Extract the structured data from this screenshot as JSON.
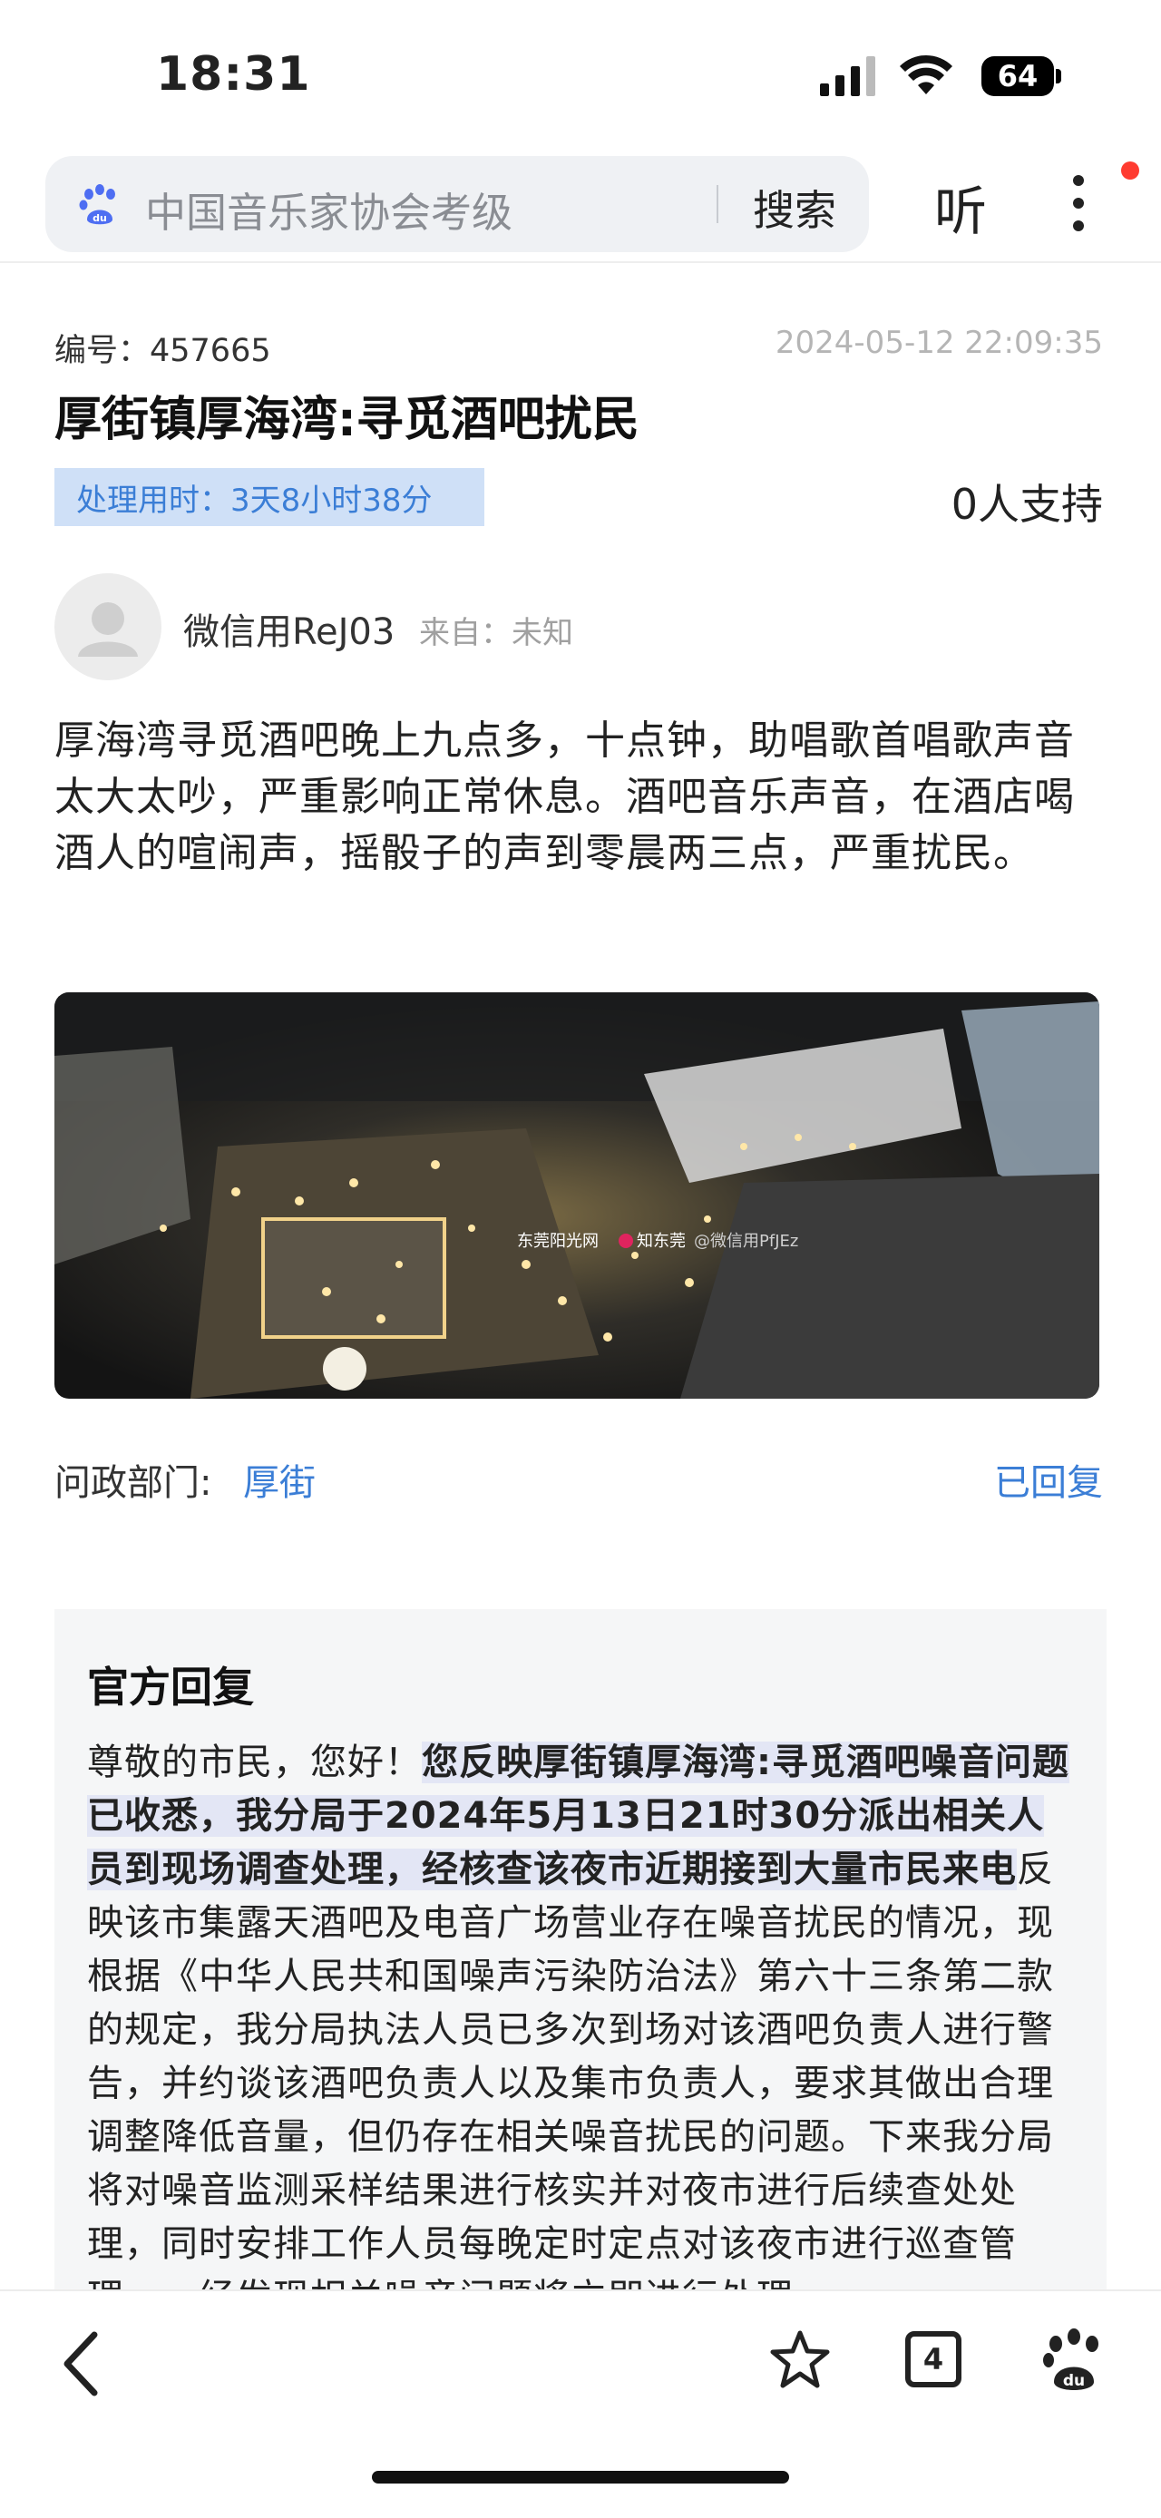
{
  "status_bar": {
    "time": "18:31",
    "battery": "64"
  },
  "header": {
    "search_text": "中国音乐家协会考级",
    "search_button": "搜索",
    "listen_button": "听"
  },
  "post": {
    "id_label": "编号：457665",
    "datetime": "2024-05-12 22:09:35",
    "title": "厚街镇厚海湾:寻觅酒吧扰民",
    "processing_time": "处理用时：3天8小时38分",
    "support_count": "0人支持",
    "user_name": "微信用ReJ03",
    "from_label": "来自：未知",
    "content": "厚海湾寻觅酒吧晚上九点多，十点钟，助唱歌首唱歌声音太大太吵，严重影响正常休息。酒吧音乐声音，在酒店喝酒人的喧闹声，摇骰子的声到零晨两三点，严重扰民。",
    "photo_watermark_1": "东莞阳光网",
    "photo_watermark_2": "知东莞",
    "photo_watermark_3": "@微信用PfJEz",
    "dept_label": "问政部门:",
    "dept_value": "厚街",
    "reply_status": "已回复"
  },
  "official_reply": {
    "title": "官方回复",
    "greeting": "尊敬的市民，您好！",
    "highlight": "您反映厚街镇厚海湾:寻觅酒吧噪音问题已收悉，我分局于2024年5月13日21时30分派出相关人员到现场调查处理，经核查该夜市近期接到大量市民来电",
    "body": "反映该市集露天酒吧及电音广场营业存在噪音扰民的情况，现根据《中华人民共和国噪声污染防治法》第六十三条第二款的规定，我分局执法人员已多次到场对该酒吧负责人进行警告，并约谈该酒吧负责人以及集市负责人，要求其做出合理调整降低音量，但仍存在相关噪音扰民的问题。下来我分局将对噪音监测采样结果进行核实并对夜市进行后续查处处理，同时安排工作人员每晚定时定点对该夜市进行巡查管理，一经发现相关噪音问题将立即进行处理。"
  },
  "bottom_bar": {
    "tabs_count": "4"
  },
  "colors": {
    "accent": "#3b7ed6",
    "badge_bg": "#cfe0f7",
    "reply_bg": "#f5f6f7"
  },
  "icons": [
    "baidu-paw-icon",
    "more-vertical-icon",
    "back-chevron-icon",
    "star-icon",
    "tabs-icon",
    "baidu-du-icon"
  ]
}
